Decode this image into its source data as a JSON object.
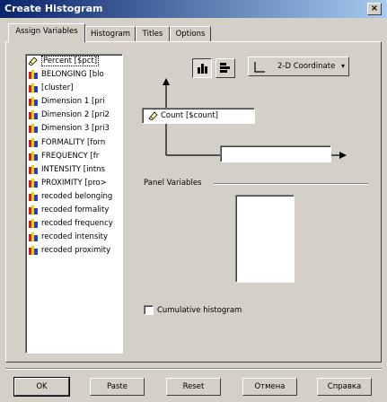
{
  "window": {
    "title": "Create Histogram",
    "close_label": "×"
  },
  "tabs": [
    {
      "label": "Assign Variables",
      "active": true
    },
    {
      "label": "Histogram"
    },
    {
      "label": "Titles"
    },
    {
      "label": "Options"
    }
  ],
  "variables": [
    {
      "label": "Percent [$pct]",
      "icon": "scale-ruler-icon",
      "selected": true
    },
    {
      "label": "BELONGING [blo",
      "icon": "ordinal-bars-icon"
    },
    {
      "label": "[cluster]",
      "icon": "ordinal-bars-icon"
    },
    {
      "label": "Dimension 1 [pri",
      "icon": "ordinal-bars-icon"
    },
    {
      "label": "Dimension 2 [pri2",
      "icon": "ordinal-bars-icon"
    },
    {
      "label": "Dimension 3 [pri3",
      "icon": "ordinal-bars-icon"
    },
    {
      "label": "FORMALITY [forn",
      "icon": "ordinal-bars-icon"
    },
    {
      "label": "FREQUENCY [fr",
      "icon": "ordinal-bars-icon"
    },
    {
      "label": "INTENSITY [intns",
      "icon": "ordinal-bars-icon"
    },
    {
      "label": "PROXIMITY [pro>",
      "icon": "ordinal-bars-icon"
    },
    {
      "label": "recoded belonging",
      "icon": "ordinal-bars-icon"
    },
    {
      "label": "recoded formality",
      "icon": "ordinal-bars-icon"
    },
    {
      "label": "recoded frequency",
      "icon": "ordinal-bars-icon"
    },
    {
      "label": "recoded intensity",
      "icon": "ordinal-bars-icon"
    },
    {
      "label": "recoded proximity",
      "icon": "ordinal-bars-icon"
    }
  ],
  "toolbar": {
    "chart_type_icon": "bar-chart-icon",
    "swap_axes_icon": "horizontal-bar-icon",
    "coordinate_label": "2-D Coordinate"
  },
  "axes": {
    "y_field_value": "Count [$count]",
    "x_field_value": ""
  },
  "panel_variables": {
    "label": "Panel Variables"
  },
  "cumulative": {
    "label": "Cumulative histogram",
    "checked": false
  },
  "buttons": {
    "ok": "OK",
    "paste": "Paste",
    "reset": "Reset",
    "cancel": "Отмена",
    "help": "Справка"
  }
}
